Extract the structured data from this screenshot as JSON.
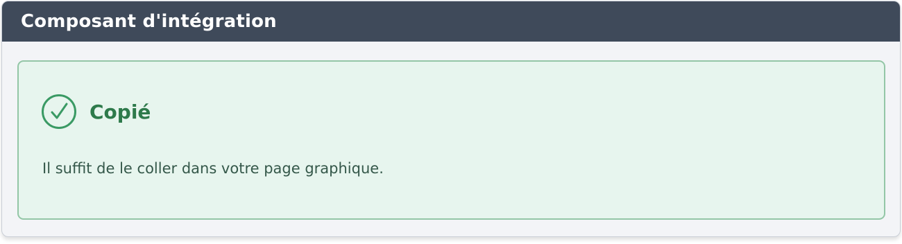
{
  "panel": {
    "title": "Composant d'intégration"
  },
  "notice": {
    "status": "success",
    "icon": "check-circle-icon",
    "title": "Copié",
    "message": "Il suffit de le coller dans votre page graphique."
  },
  "colors": {
    "header_bg": "#3f4a5a",
    "success_bg": "#e7f5ee",
    "success_border": "#93c6a6",
    "success_accent": "#3a9a64",
    "success_title": "#2e7a4b"
  }
}
